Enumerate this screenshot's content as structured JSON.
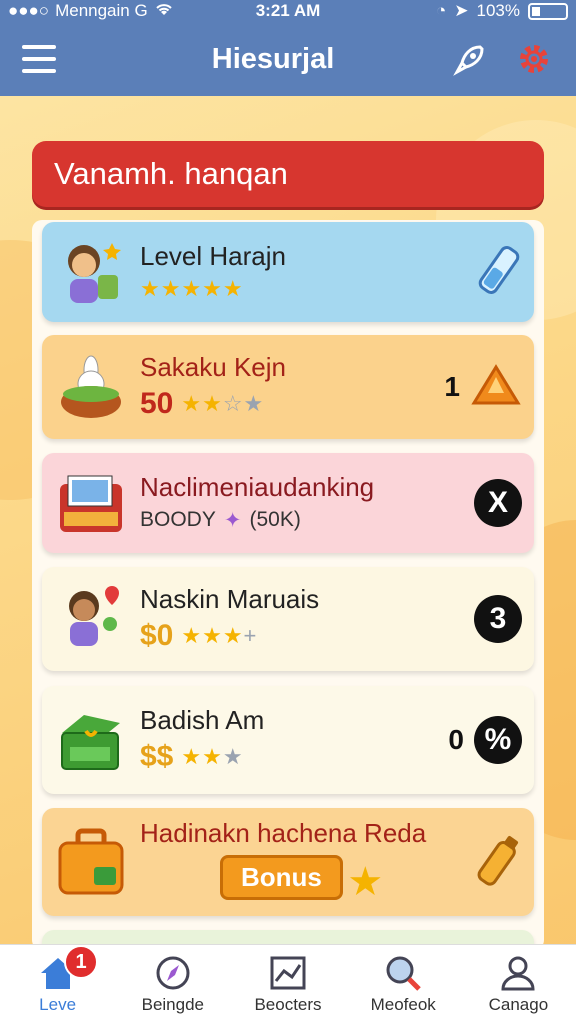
{
  "status": {
    "carrier": "Menngain G",
    "time": "3:21 AM",
    "battery": "103%"
  },
  "appbar": {
    "title": "Hiesurjal"
  },
  "banner": {
    "text": "Vanamh. hanqan"
  },
  "cards": [
    {
      "name": "Level Harajn",
      "amount": "",
      "stars_on": 5,
      "stars_total": 5,
      "count": "",
      "badge": ""
    },
    {
      "name": "Sakaku Kejn",
      "amount": "50",
      "stars_on": 2,
      "stars_total": 4,
      "count": "1",
      "badge": ""
    },
    {
      "name": "Naclimeniaudanking",
      "amount": "",
      "sub_text": "BOODY",
      "sub_extra": "(50K)",
      "count": "",
      "badge": "X"
    },
    {
      "name": "Naskin Maruais",
      "amount": "$0",
      "stars_on": 3,
      "stars_total": 4,
      "count": "",
      "badge": "3"
    },
    {
      "name": "Badish Am",
      "amount": "$$",
      "stars_on": 2,
      "stars_total": 4,
      "count": "0",
      "badge": "%"
    },
    {
      "name": "Hadinakn hachena Reda",
      "amount": "",
      "button": "Bonus",
      "count": "",
      "badge": ""
    }
  ],
  "nav": [
    {
      "label": "Leve",
      "icon": "home-icon",
      "active": true,
      "notification": "1"
    },
    {
      "label": "Beingde",
      "icon": "compass-icon",
      "active": false
    },
    {
      "label": "Beocters",
      "icon": "chart-icon",
      "active": false
    },
    {
      "label": "Meofeok",
      "icon": "magnifier-icon",
      "active": false
    },
    {
      "label": "Canago",
      "icon": "profile-icon",
      "active": false
    }
  ],
  "colors": {
    "header": "#5b7fb8",
    "banner": "#d7362f",
    "amount_red": "#c0281c",
    "amount_gold": "#e6a21a",
    "nav_active": "#3b7dd8"
  }
}
